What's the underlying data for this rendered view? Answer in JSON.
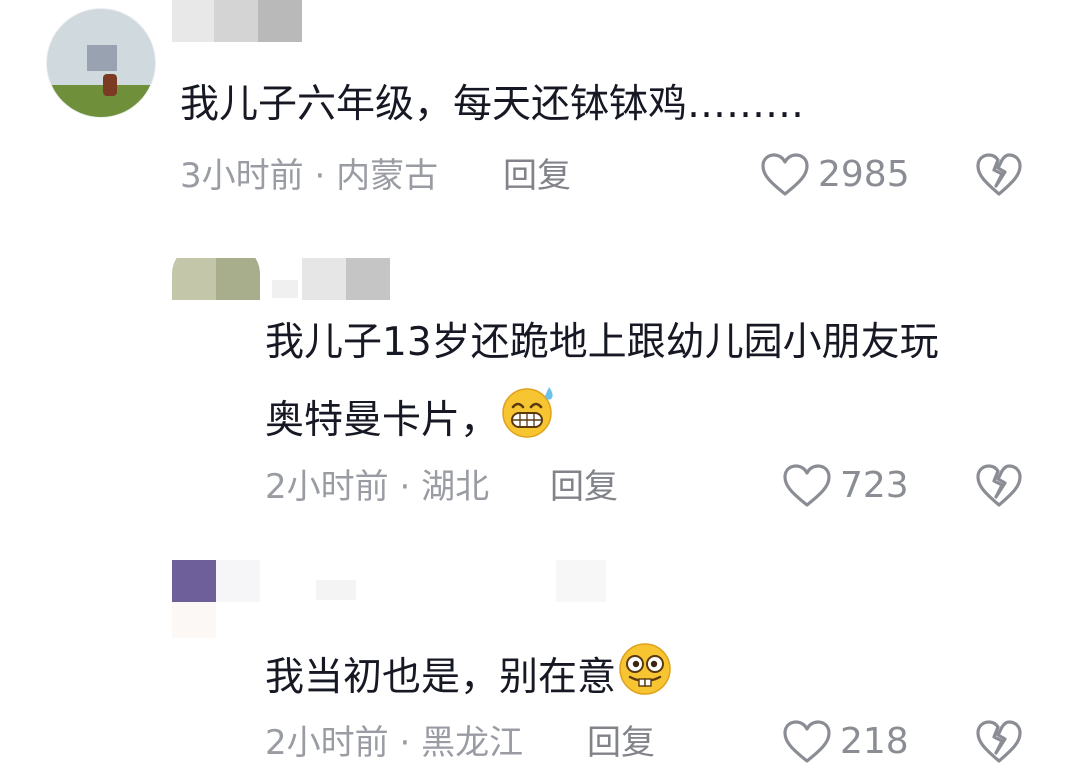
{
  "comments": [
    {
      "text": "我儿子六年级，每天还钵钵鸡………",
      "time": "3小时前",
      "sep": "·",
      "location": "内蒙古",
      "reply_label": "回复",
      "likes": "2985",
      "emoji": ""
    },
    {
      "text_line1": "我儿子13岁还跪地上跟幼儿园小朋友玩",
      "text_line2": "奥特曼卡片，",
      "time": "2小时前",
      "sep": "·",
      "location": "湖北",
      "reply_label": "回复",
      "likes": "723",
      "emoji": "sweat-grin-emoji"
    },
    {
      "text": "我当初也是，别在意",
      "time": "2小时前",
      "sep": "·",
      "location": "黑龙江",
      "reply_label": "回复",
      "likes": "218",
      "emoji": "goofy-bucktooth-emoji"
    }
  ],
  "colors": {
    "text": "#161823",
    "meta": "#9a9ca4",
    "icon": "#8a8d94",
    "emoji_yellow": "#f7c531"
  }
}
